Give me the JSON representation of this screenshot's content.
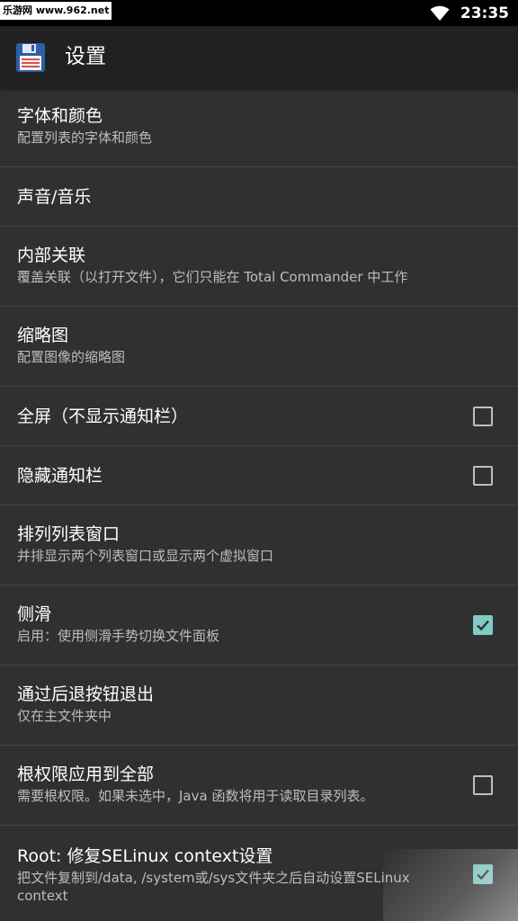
{
  "status_bar": {
    "watermark": "乐游网 www.962.net",
    "time": "23:35",
    "wifi_icon": "wifi-icon"
  },
  "app_bar": {
    "icon": "floppy-disk-icon",
    "title": "设置"
  },
  "settings": [
    {
      "title": "字体和颜色",
      "summary": "配置列表的字体和颜色",
      "checkbox": null
    },
    {
      "title": "声音/音乐",
      "summary": "",
      "checkbox": null
    },
    {
      "title": "内部关联",
      "summary": "覆盖关联（以打开文件），它们只能在 Total Commander 中工作",
      "checkbox": null
    },
    {
      "title": "缩略图",
      "summary": "配置图像的缩略图",
      "checkbox": null
    },
    {
      "title": "全屏（不显示通知栏）",
      "summary": "",
      "checkbox": false
    },
    {
      "title": "隐藏通知栏",
      "summary": "",
      "checkbox": false
    },
    {
      "title": "排列列表窗口",
      "summary": "并排显示两个列表窗口或显示两个虚拟窗口",
      "checkbox": null
    },
    {
      "title": "侧滑",
      "summary": "启用：使用侧滑手势切换文件面板",
      "checkbox": true
    },
    {
      "title": "通过后退按钮退出",
      "summary": "仅在主文件夹中",
      "checkbox": null
    },
    {
      "title": "根权限应用到全部",
      "summary": "需要根权限。如果未选中，Java 函数将用于读取目录列表。",
      "checkbox": false
    },
    {
      "title": "Root: 修复SELinux context设置",
      "summary": "把文件复制到/data, /system或/sys文件夹之后自动设置SELinux context",
      "checkbox": true
    }
  ],
  "colors": {
    "background": "#303030",
    "app_bar": "#212121",
    "accent": "#80cbc4",
    "summary_text": "#bdbdbd"
  }
}
